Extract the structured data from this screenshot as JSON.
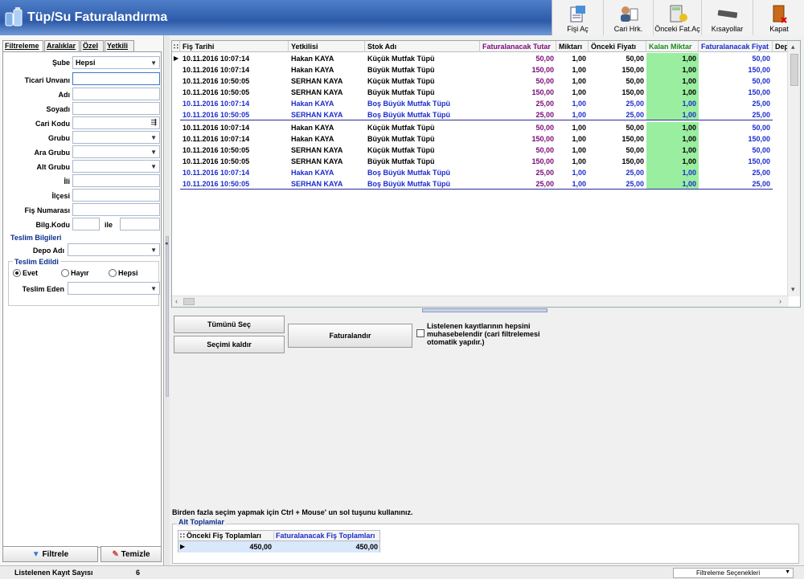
{
  "window": {
    "title": "Tüp/Su Faturalandırma"
  },
  "toolbar": {
    "buttons": [
      "Fişi Aç",
      "Cari Hrk.",
      "Önceki Fat.Aç",
      "Kısayollar",
      "Kapat"
    ]
  },
  "left": {
    "tabs": [
      "Filtreleme",
      "Aralıklar",
      "Özel",
      "Yetkili"
    ],
    "fields": {
      "sube_label": "Şube",
      "sube_value": "Hepsi",
      "ticari_label": "Ticari Unvanı",
      "adi_label": "Adı",
      "soyadi_label": "Soyadı",
      "cari_kodu_label": "Cari Kodu",
      "grubu_label": "Grubu",
      "ara_grubu_label": "Ara Grubu",
      "alt_grubu_label": "Alt Grubu",
      "ili_label": "İli",
      "ilcesi_label": "İlçesi",
      "fis_no_label": "Fiş Numarası",
      "bilg_kodu_label": "Bilg.Kodu",
      "ile_label": "ile"
    },
    "teslim": {
      "title": "Teslim Bilgileri",
      "depo_label": "Depo Adı",
      "edildi_title": "Teslim Edildi",
      "radios": [
        "Evet",
        "Hayır",
        "Hepsi"
      ],
      "teslim_eden_label": "Teslim Eden"
    },
    "buttons": {
      "filtrele": "Filtrele",
      "temizle": "Temizle"
    }
  },
  "grid": {
    "columns": [
      "Fiş Tarihi",
      "Yetkilisi",
      "Stok Adı",
      "Faturalanacak Tutar",
      "Miktarı",
      "Önceki Fiyatı",
      "Kalan Miktar",
      "Faturalanacak Fiyat",
      "Dep"
    ],
    "rows": [
      [
        "10.11.2016 10:07:14",
        "Hakan KAYA",
        "Küçük Mutfak Tüpü",
        "50,00",
        "1,00",
        "50,00",
        "1,00",
        "50,00"
      ],
      [
        "10.11.2016 10:07:14",
        "Hakan KAYA",
        "Büyük Mutfak Tüpü",
        "150,00",
        "1,00",
        "150,00",
        "1,00",
        "150,00"
      ],
      [
        "10.11.2016 10:50:05",
        "SERHAN KAYA",
        "Küçük Mutfak Tüpü",
        "50,00",
        "1,00",
        "50,00",
        "1,00",
        "50,00"
      ],
      [
        "10.11.2016 10:50:05",
        "SERHAN KAYA",
        "Büyük Mutfak Tüpü",
        "150,00",
        "1,00",
        "150,00",
        "1,00",
        "150,00"
      ],
      [
        "10.11.2016 10:07:14",
        "Hakan KAYA",
        "Boş Büyük Mutfak Tüpü",
        "25,00",
        "1,00",
        "25,00",
        "1,00",
        "25,00"
      ],
      [
        "10.11.2016 10:50:05",
        "SERHAN KAYA",
        "Boş Büyük Mutfak Tüpü",
        "25,00",
        "1,00",
        "25,00",
        "1,00",
        "25,00"
      ],
      [
        "10.11.2016 10:07:14",
        "Hakan KAYA",
        "Küçük Mutfak Tüpü",
        "50,00",
        "1,00",
        "50,00",
        "1,00",
        "50,00"
      ],
      [
        "10.11.2016 10:07:14",
        "Hakan KAYA",
        "Büyük Mutfak Tüpü",
        "150,00",
        "1,00",
        "150,00",
        "1,00",
        "150,00"
      ],
      [
        "10.11.2016 10:50:05",
        "SERHAN KAYA",
        "Küçük Mutfak Tüpü",
        "50,00",
        "1,00",
        "50,00",
        "1,00",
        "50,00"
      ],
      [
        "10.11.2016 10:50:05",
        "SERHAN KAYA",
        "Büyük Mutfak Tüpü",
        "150,00",
        "1,00",
        "150,00",
        "1,00",
        "150,00"
      ],
      [
        "10.11.2016 10:07:14",
        "Hakan KAYA",
        "Boş Büyük Mutfak Tüpü",
        "25,00",
        "1,00",
        "25,00",
        "1,00",
        "25,00"
      ],
      [
        "10.11.2016 10:50:05",
        "SERHAN KAYA",
        "Boş Büyük Mutfak Tüpü",
        "25,00",
        "1,00",
        "25,00",
        "1,00",
        "25,00"
      ]
    ],
    "blue_rows": [
      4,
      5,
      10,
      11
    ]
  },
  "actions": {
    "select_all": "Tümünü Seç",
    "deselect": "Seçimi kaldır",
    "invoice": "Faturalandır",
    "checkbox_text": "Listelenen kayıtlarının hepsini muhasebelendir (cari filtrelemesi otomatik yapılır.)"
  },
  "hint": "Birden fazla seçim yapmak için Ctrl + Mouse' un sol tuşunu kullanınız.",
  "subtotals": {
    "title": "Alt Toplamlar",
    "columns": [
      "Önceki Fiş Toplamları",
      "Faturalanacak Fiş Toplamları"
    ],
    "values": [
      "450,00",
      "450,00"
    ]
  },
  "status": {
    "record_label": "Listelenen Kayıt Sayısı",
    "record_count": "6",
    "filter_options": "Filtreleme Seçenekleri"
  },
  "colors": {
    "title_bg": "#2d5aa8",
    "green": "#9aeea0",
    "purple": "#7a0a78",
    "blue": "#1a2ccc"
  }
}
